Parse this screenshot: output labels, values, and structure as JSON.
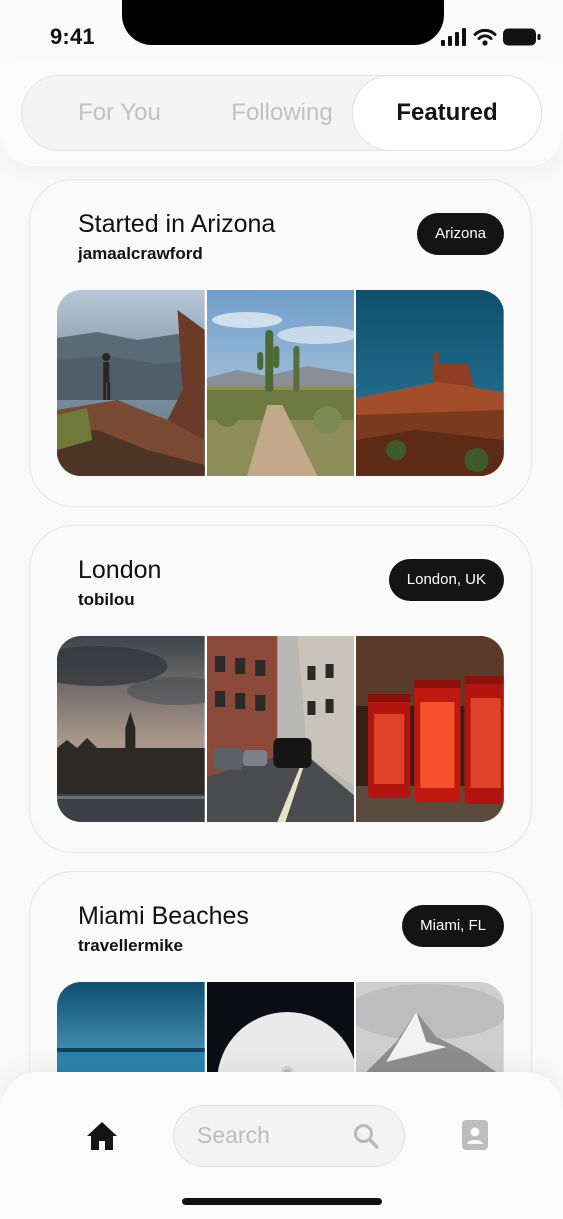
{
  "status_bar": {
    "time": "9:41"
  },
  "tabs": [
    {
      "label": "For You",
      "selected": false
    },
    {
      "label": "Following",
      "selected": false
    },
    {
      "label": "Featured",
      "selected": true
    }
  ],
  "cards": [
    {
      "title": "Started in Arizona",
      "user": "jamaalcrawford",
      "location": "Arizona",
      "photos": [
        "canyon-hiker-photo",
        "desert-cactus-path-photo",
        "monument-valley-butte-photo"
      ]
    },
    {
      "title": "London",
      "user": "tobilou",
      "location": "London, UK",
      "photos": [
        "big-ben-skyline-photo",
        "london-street-taxi-photo",
        "red-phone-boxes-photo"
      ]
    },
    {
      "title": "Miami Beaches",
      "user": "travellermike",
      "location": "Miami, FL",
      "photos": [
        "ocean-sky-photo",
        "moon-photo",
        "snowy-mountain-photo"
      ]
    }
  ],
  "bottom_nav": {
    "home_icon": "home-icon",
    "search_placeholder": "Search",
    "search_icon": "search-icon",
    "profile_icon": "profile-icon"
  },
  "colors": {
    "badge_bg": "#141414",
    "inactive_tab": "#c2c2c2",
    "background": "#fafafa"
  }
}
